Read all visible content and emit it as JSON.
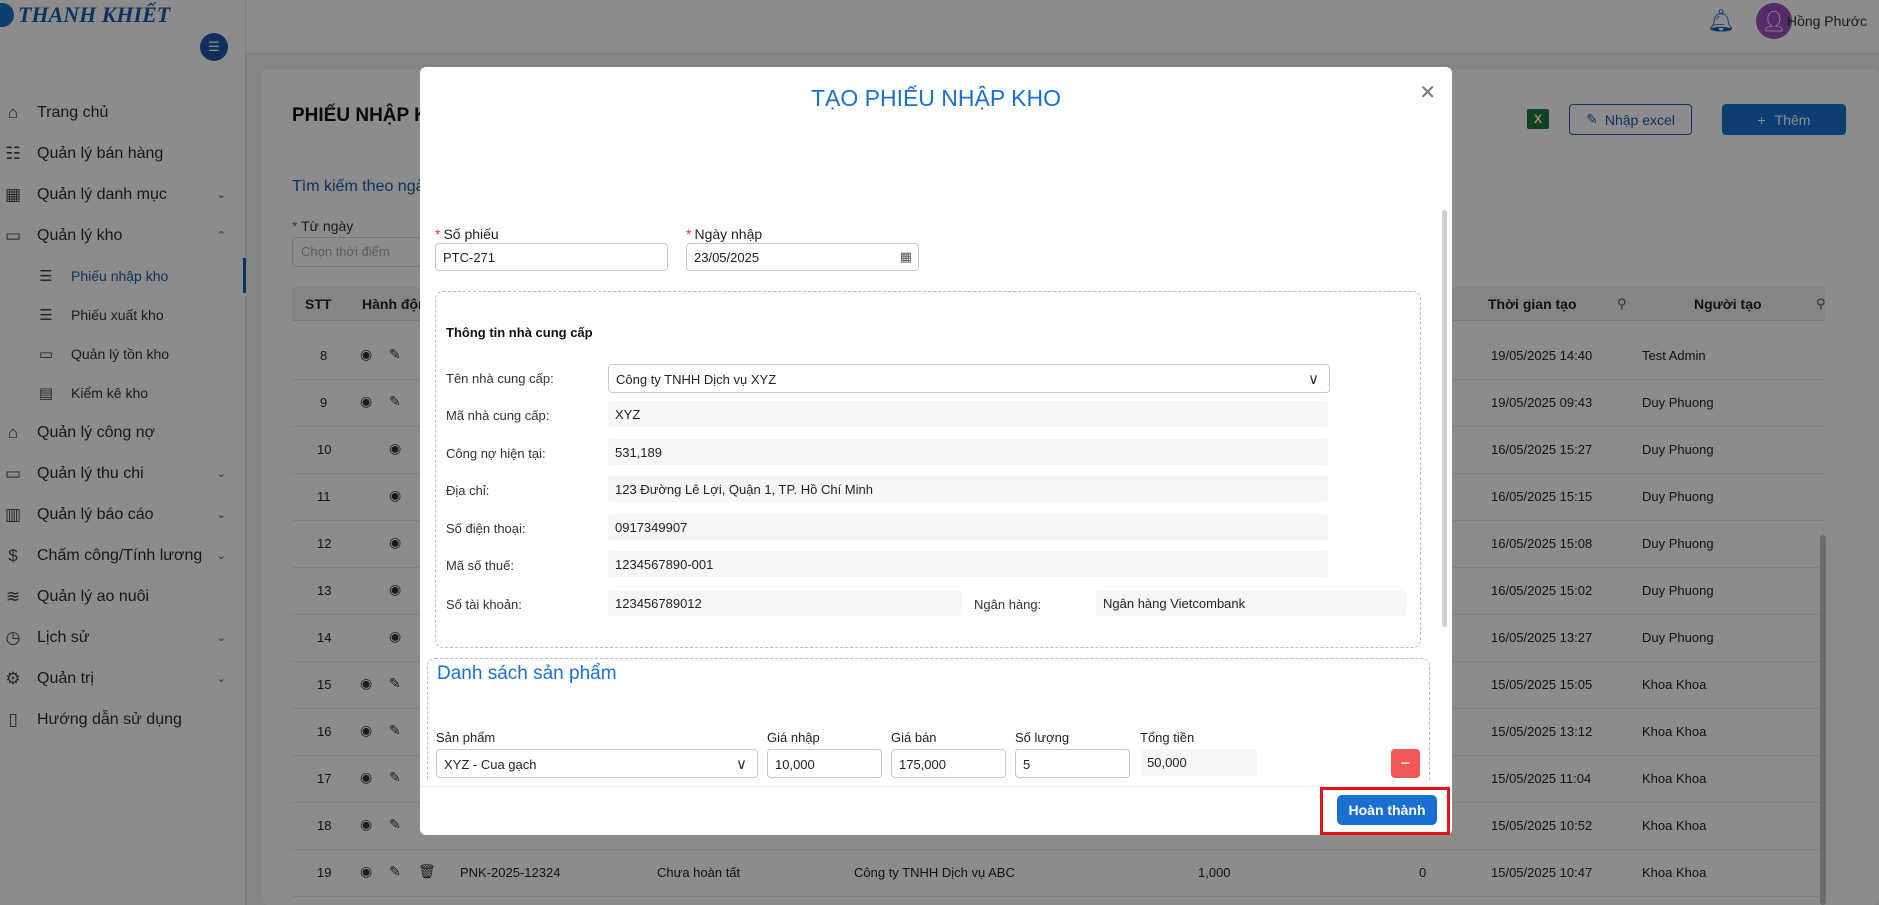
{
  "app": {
    "brand": "THANH KHIẾT",
    "user_name": "Hồng Phước"
  },
  "sidebar": {
    "items": [
      {
        "label": "Trang chủ",
        "icon": "home-icon"
      },
      {
        "label": "Quản lý bán hàng",
        "icon": "sales-icon"
      },
      {
        "label": "Quản lý danh mục",
        "icon": "grid-icon"
      },
      {
        "label": "Quản lý kho",
        "icon": "warehouse-icon"
      },
      {
        "label": "Quản lý công nợ",
        "icon": "bank-icon"
      },
      {
        "label": "Quản lý thu chi",
        "icon": "wallet-icon"
      },
      {
        "label": "Quản lý báo cáo",
        "icon": "chart-icon"
      },
      {
        "label": "Chấm công/Tính lương",
        "icon": "dollar-icon"
      },
      {
        "label": "Quản lý ao nuôi",
        "icon": "water-icon"
      },
      {
        "label": "Lịch sử",
        "icon": "clock-icon"
      },
      {
        "label": "Quản trị",
        "icon": "gear-icon"
      },
      {
        "label": "Hướng dẫn sử dụng",
        "icon": "book-icon"
      }
    ],
    "warehouse_sub": [
      {
        "label": "Phiếu nhập kho"
      },
      {
        "label": "Phiếu xuất kho"
      },
      {
        "label": "Quản lý tồn kho"
      },
      {
        "label": "Kiểm kê kho"
      }
    ]
  },
  "page": {
    "title": "PHIẾU NHẬP K",
    "import_excel_label": "Nhập excel",
    "add_label": "Thêm",
    "search_title": "Tìm kiếm theo ngà",
    "from_date_label": "Từ ngày",
    "from_date_placeholder": "Chọn thời điểm"
  },
  "table": {
    "headers": {
      "stt": "STT",
      "actions": "Hành độn",
      "created_time": "Thời gian tạo",
      "creator": "Người tạo"
    },
    "rows": [
      {
        "stt": "8",
        "time": "19/05/2025 14:40",
        "creator": "Test Admin",
        "edit": true
      },
      {
        "stt": "9",
        "time": "19/05/2025 09:43",
        "creator": "Duy Phuong",
        "edit": true
      },
      {
        "stt": "10",
        "time": "16/05/2025 15:27",
        "creator": "Duy Phuong",
        "edit": false
      },
      {
        "stt": "11",
        "time": "16/05/2025 15:15",
        "creator": "Duy Phuong",
        "edit": false
      },
      {
        "stt": "12",
        "time": "16/05/2025 15:08",
        "creator": "Duy Phuong",
        "edit": false
      },
      {
        "stt": "13",
        "time": "16/05/2025 15:02",
        "creator": "Duy Phuong",
        "edit": false
      },
      {
        "stt": "14",
        "time": "16/05/2025 13:27",
        "creator": "Duy Phuong",
        "edit": false
      },
      {
        "stt": "15",
        "time": "15/05/2025 15:05",
        "creator": "Khoa Khoa",
        "edit": true
      },
      {
        "stt": "16",
        "time": "15/05/2025 13:12",
        "creator": "Khoa Khoa",
        "edit": true
      },
      {
        "stt": "17",
        "time": "15/05/2025 11:04",
        "creator": "Khoa Khoa",
        "edit": true
      },
      {
        "stt": "18",
        "time": "15/05/2025 10:52",
        "creator": "Khoa Khoa",
        "edit": true
      },
      {
        "stt": "19",
        "time": "15/05/2025 10:47",
        "creator": "Khoa Khoa",
        "edit": true
      }
    ],
    "last_row_extra": {
      "code": "PNK-2025-12324",
      "status": "Chưa hoàn tất",
      "supplier": "Công ty TNHH Dịch vụ ABC",
      "amount": "1,000",
      "debt": "0"
    }
  },
  "modal": {
    "title": "TẠO PHIẾU NHẬP KHO",
    "receipt_no_label": "Số phiếu",
    "receipt_no_value": "PTC-271",
    "date_label": "Ngày nhập",
    "date_value": "23/05/2025",
    "supplier_section_title": "Thông tin nhà cung cấp",
    "supplier": {
      "name_label": "Tên nhà cung cấp:",
      "name_value": "Công ty TNHH Dịch vụ XYZ",
      "code_label": "Mã nhà cung cấp:",
      "code_value": "XYZ",
      "debt_label": "Công nợ hiện tại:",
      "debt_value": "531,189",
      "address_label": "Địa chỉ:",
      "address_value": "123 Đường Lê Lợi, Quận 1, TP. Hồ Chí Minh",
      "phone_label": "Số điện thoại:",
      "phone_value": "0917349907",
      "tax_label": "Mã số thuế:",
      "tax_value": "1234567890-001",
      "account_label": "Số tài khoản:",
      "account_value": "123456789012",
      "bank_label": "Ngân hàng:",
      "bank_value": "Ngân hàng Vietcombank"
    },
    "products_title": "Danh sách sản phẩm",
    "product_cols": {
      "product": "Sản phẩm",
      "import_price": "Giá nhập",
      "sale_price": "Giá bán",
      "quantity": "Số lượng",
      "total": "Tổng tiền"
    },
    "product_row": {
      "product": "XYZ - Cua gạch",
      "import_price": "10,000",
      "sale_price": "175,000",
      "quantity": "5",
      "total": "50,000"
    },
    "done_label": "Hoàn thành"
  },
  "colors": {
    "primary": "#1a6fd1",
    "danger": "#f25757",
    "success": "#1d8a2c",
    "highlight": "#e0161b"
  }
}
